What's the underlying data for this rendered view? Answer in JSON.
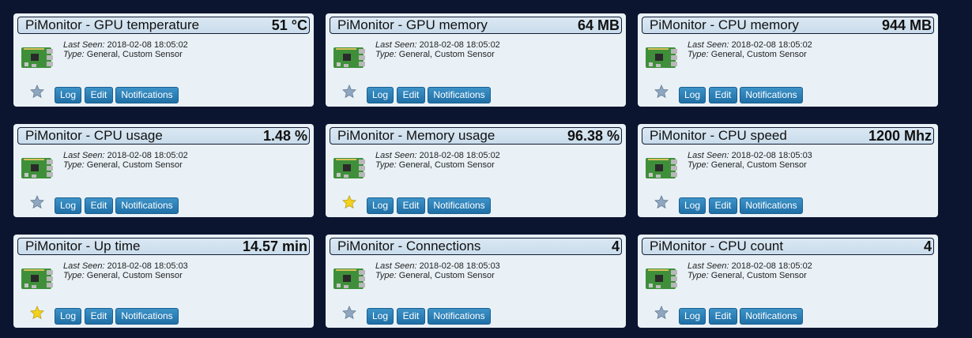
{
  "labels": {
    "last_seen": "Last Seen:",
    "type": "Type:",
    "log": "Log",
    "edit": "Edit",
    "notifications": "Notifications"
  },
  "colors": {
    "background": "#0c1530",
    "card": "#e9f1f7",
    "button": "#2a7db6",
    "star_on": "#f2d21c",
    "star_off": "#8fa6bf"
  },
  "cards": [
    {
      "title": "PiMonitor - GPU temperature",
      "value": "51 °C",
      "last_seen": "2018-02-08 18:05:02",
      "type": "General, Custom Sensor",
      "favorite": false
    },
    {
      "title": "PiMonitor - GPU memory",
      "value": "64 MB",
      "last_seen": "2018-02-08 18:05:02",
      "type": "General, Custom Sensor",
      "favorite": false
    },
    {
      "title": "PiMonitor - CPU memory",
      "value": "944 MB",
      "last_seen": "2018-02-08 18:05:02",
      "type": "General, Custom Sensor",
      "favorite": false
    },
    {
      "title": "PiMonitor - CPU usage",
      "value": "1.48 %",
      "last_seen": "2018-02-08 18:05:02",
      "type": "General, Custom Sensor",
      "favorite": false
    },
    {
      "title": "PiMonitor - Memory usage",
      "value": "96.38 %",
      "last_seen": "2018-02-08 18:05:02",
      "type": "General, Custom Sensor",
      "favorite": true
    },
    {
      "title": "PiMonitor - CPU speed",
      "value": "1200 Mhz",
      "last_seen": "2018-02-08 18:05:03",
      "type": "General, Custom Sensor",
      "favorite": false
    },
    {
      "title": "PiMonitor - Up time",
      "value": "14.57 min",
      "last_seen": "2018-02-08 18:05:03",
      "type": "General, Custom Sensor",
      "favorite": true
    },
    {
      "title": "PiMonitor - Connections",
      "value": "4",
      "last_seen": "2018-02-08 18:05:03",
      "type": "General, Custom Sensor",
      "favorite": false
    },
    {
      "title": "PiMonitor - CPU count",
      "value": "4",
      "last_seen": "2018-02-08 18:05:02",
      "type": "General, Custom Sensor",
      "favorite": false
    }
  ]
}
